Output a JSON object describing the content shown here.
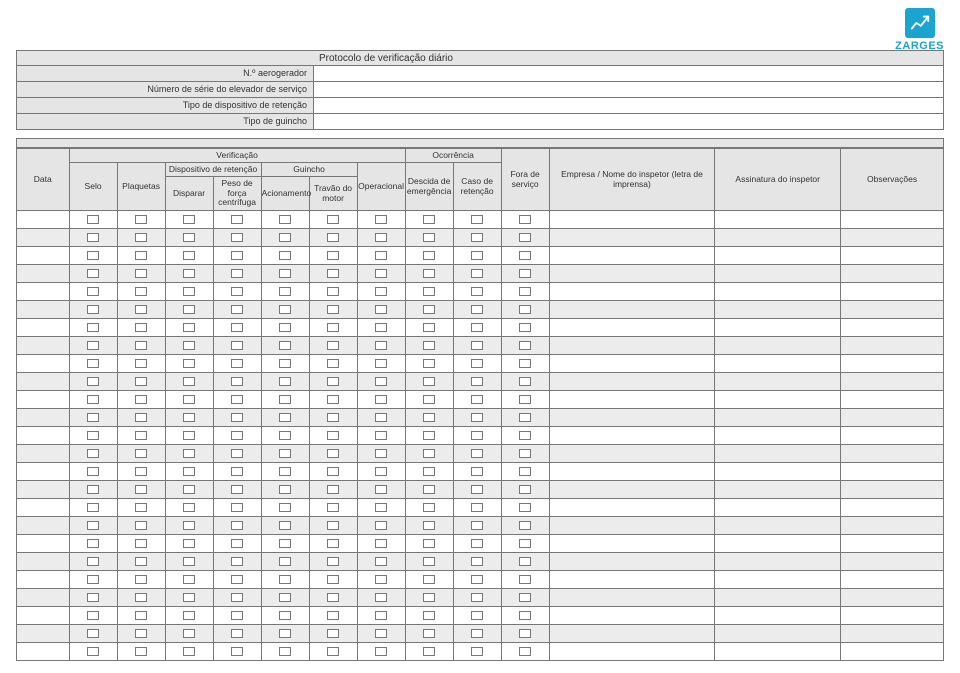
{
  "brand": "ZARGES",
  "protocol_title": "Protocolo de verificação diário",
  "meta": {
    "aerogerador": "N.º aerogerador",
    "numero_serie": "Número de série do elevador de serviço",
    "tipo_disp": "Tipo de dispositivo de retenção",
    "tipo_guincho": "Tipo de guincho"
  },
  "headers": {
    "data": "Data",
    "verificacao": "Verificação",
    "ocorrencia": "Ocorrência",
    "selo": "Selo",
    "plaquetas": "Plaquetas",
    "disp_retencao": "Dispositivo de retenção",
    "guincho": "Guincho",
    "disparar": "Disparar",
    "peso": "Peso de força centrífuga",
    "acionamento": "Acionamento",
    "travao": "Travão do motor",
    "operacional": "Operacional",
    "descida": "Descida de emergência",
    "caso_ret": "Caso de retenção",
    "fora_serv": "Fora de serviço",
    "empresa": "Empresa / Nome do inspetor (letra de imprensa)",
    "assinatura": "Assinatura do inspetor",
    "obs": "Observações"
  },
  "row_count": 25
}
